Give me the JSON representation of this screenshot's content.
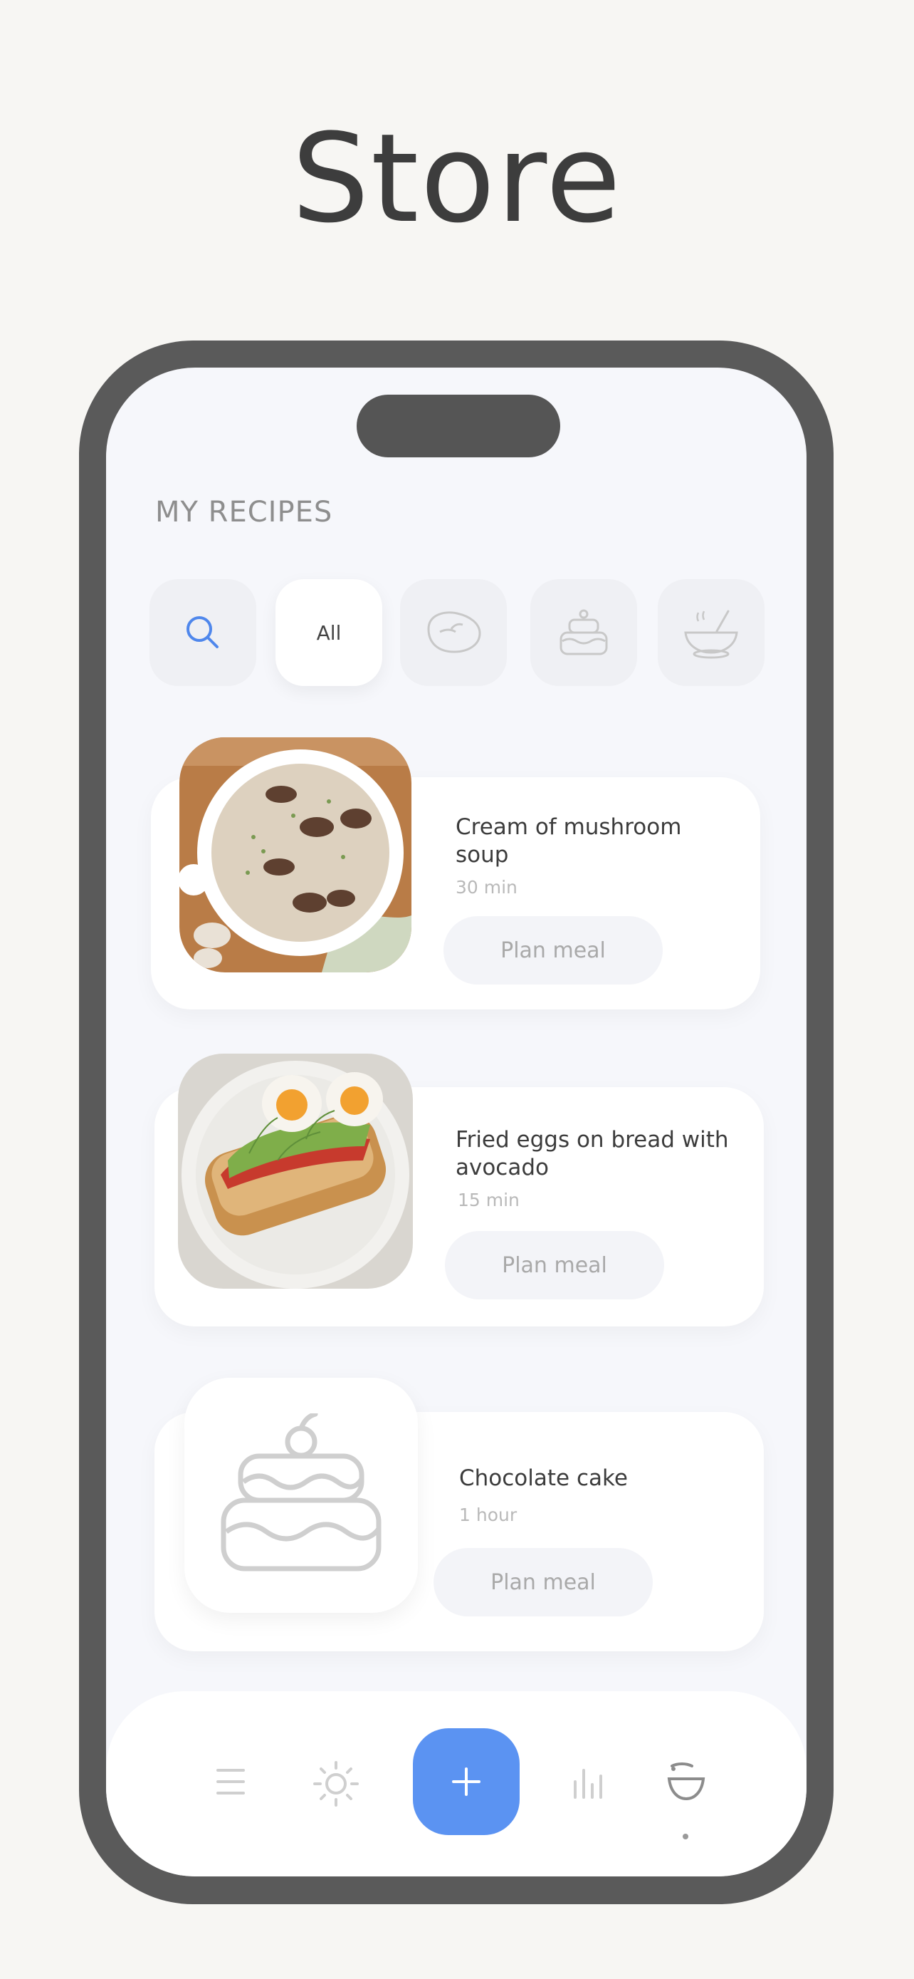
{
  "page_title": "Store",
  "screen": {
    "section_title": "MY RECIPES",
    "filters": [
      {
        "label": "",
        "icon": "search-icon"
      },
      {
        "label": "All",
        "icon": ""
      },
      {
        "label": "",
        "icon": "meat-icon"
      },
      {
        "label": "",
        "icon": "cake-icon"
      },
      {
        "label": "",
        "icon": "soup-bowl-icon"
      }
    ],
    "recipes": [
      {
        "name": "Cream of mushroom soup",
        "time": "30 min",
        "action": "Plan meal",
        "image": "mushroom-soup-photo"
      },
      {
        "name": "Fried eggs on bread with avocado",
        "time": "15 min",
        "action": "Plan meal",
        "image": "eggs-avocado-toast-photo"
      },
      {
        "name": "Chocolate cake",
        "time": "1 hour",
        "action": "Plan meal",
        "image": "cake-icon"
      }
    ],
    "tabbar": {
      "items": [
        "menu-icon",
        "sun-icon",
        "plus-icon",
        "stats-icon",
        "bowl-icon"
      ],
      "active": "bowl-icon"
    }
  },
  "colors": {
    "background": "#f7f6f3",
    "phone_frame": "#5a5a5a",
    "screen": "#f6f7fb",
    "accent": "#5b93f2",
    "icon_gray": "#c8c8c8"
  }
}
